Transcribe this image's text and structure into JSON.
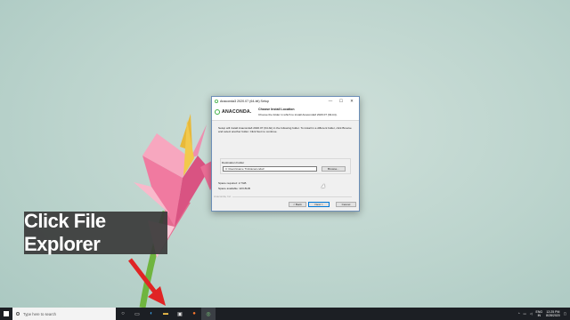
{
  "dialog": {
    "window_title": "Anaconda3 2020.07 (64-bit) Setup",
    "minimize": "—",
    "maximize": "☐",
    "close": "✕",
    "logo_text": "ANACONDA.",
    "header_title": "Choose Install Location",
    "header_subtitle": "Choose the folder in which to install Anaconda3 2020.07 (64-bit).",
    "body_text": "Setup will install Anaconda3 2020.07 (64-bit) in the following folder. To install in a different folder, click Browse and select another folder. Click Next to continue.",
    "destination_label": "Destination Folder",
    "destination_value": "C:\\Users\\Game Trick\\anaconda3",
    "browse_label": "Browse...",
    "space_required": "Space required: 2.7GB",
    "space_available": "Space available: 223.8GB",
    "brand_footer": "Anaconda, Inc.",
    "back_label": "< Back",
    "next_label": "Next >",
    "cancel_label": "Cancel"
  },
  "caption": {
    "text": "Click File Explorer"
  },
  "taskbar": {
    "search_placeholder": "Type here to search",
    "icons": [
      "task-view-icon",
      "edge-icon",
      "file-explorer-icon",
      "store-icon",
      "firefox-icon",
      "app-icon"
    ],
    "lang_line1": "ENG",
    "lang_line2": "IN",
    "time": "12:25 PM",
    "date": "8/28/2020"
  },
  "colors": {
    "accent": "#0078d7",
    "anaconda_green": "#43b049",
    "caption_bg": "#3a3a3a",
    "arrow_red": "#e02424"
  }
}
